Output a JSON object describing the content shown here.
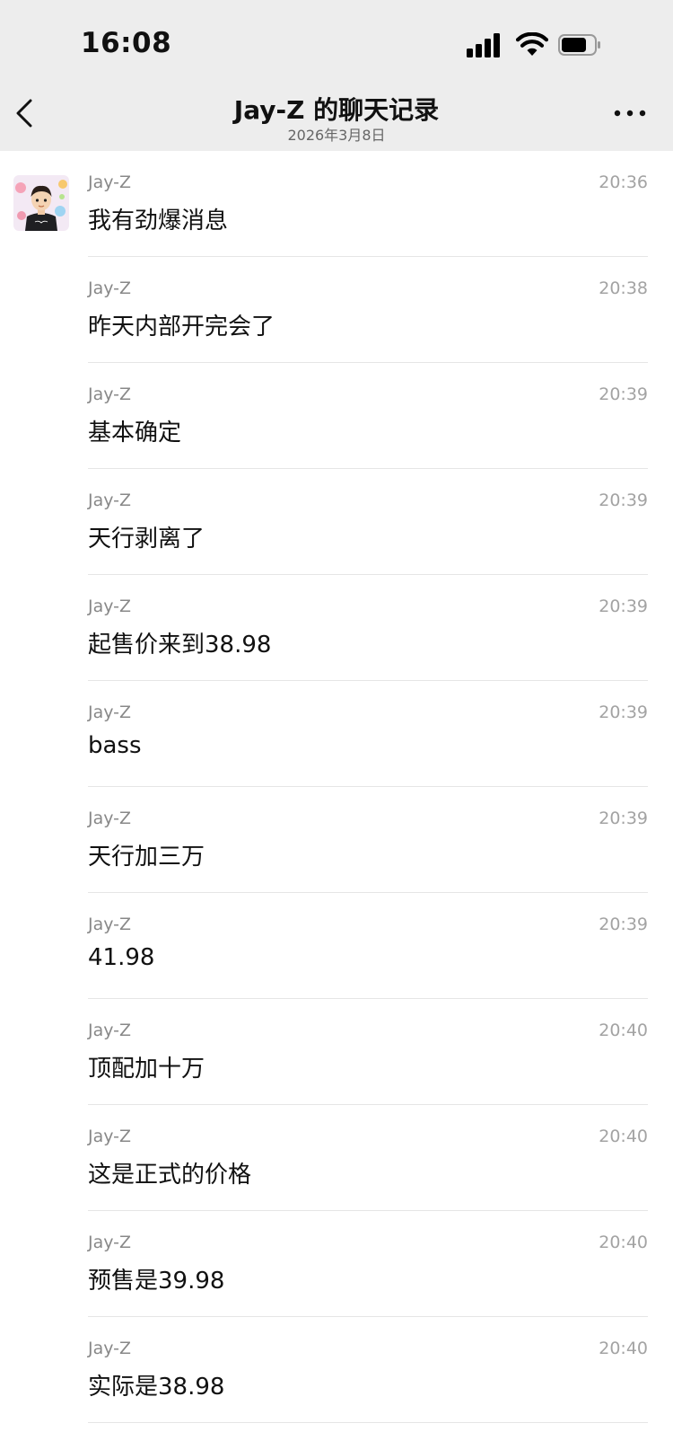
{
  "status_bar": {
    "time": "16:08",
    "icons": [
      "signal-icon",
      "wifi-icon",
      "battery-icon"
    ]
  },
  "nav": {
    "back_icon": "chevron-left-icon",
    "title": "Jay-Z 的聊天记录",
    "subtitle": "2026年3月8日",
    "more_icon": "more-icon"
  },
  "colors": {
    "header_bg": "#ededed",
    "page_bg": "#ffffff",
    "sender_text": "#888888",
    "time_text": "#a3a3a3",
    "divider": "#e5e5e5"
  },
  "messages": [
    {
      "sender": "Jay-Z",
      "time": "20:36",
      "text": "我有劲爆消息"
    },
    {
      "sender": "Jay-Z",
      "time": "20:38",
      "text": "昨天内部开完会了"
    },
    {
      "sender": "Jay-Z",
      "time": "20:39",
      "text": "基本确定"
    },
    {
      "sender": "Jay-Z",
      "time": "20:39",
      "text": "天行剥离了"
    },
    {
      "sender": "Jay-Z",
      "time": "20:39",
      "text": "起售价来到38.98"
    },
    {
      "sender": "Jay-Z",
      "time": "20:39",
      "text": "bass"
    },
    {
      "sender": "Jay-Z",
      "time": "20:39",
      "text": "天行加三万"
    },
    {
      "sender": "Jay-Z",
      "time": "20:39",
      "text": "41.98"
    },
    {
      "sender": "Jay-Z",
      "time": "20:40",
      "text": "顶配加十万"
    },
    {
      "sender": "Jay-Z",
      "time": "20:40",
      "text": "这是正式的价格"
    },
    {
      "sender": "Jay-Z",
      "time": "20:40",
      "text": "预售是39.98"
    },
    {
      "sender": "Jay-Z",
      "time": "20:40",
      "text": "实际是38.98"
    }
  ]
}
